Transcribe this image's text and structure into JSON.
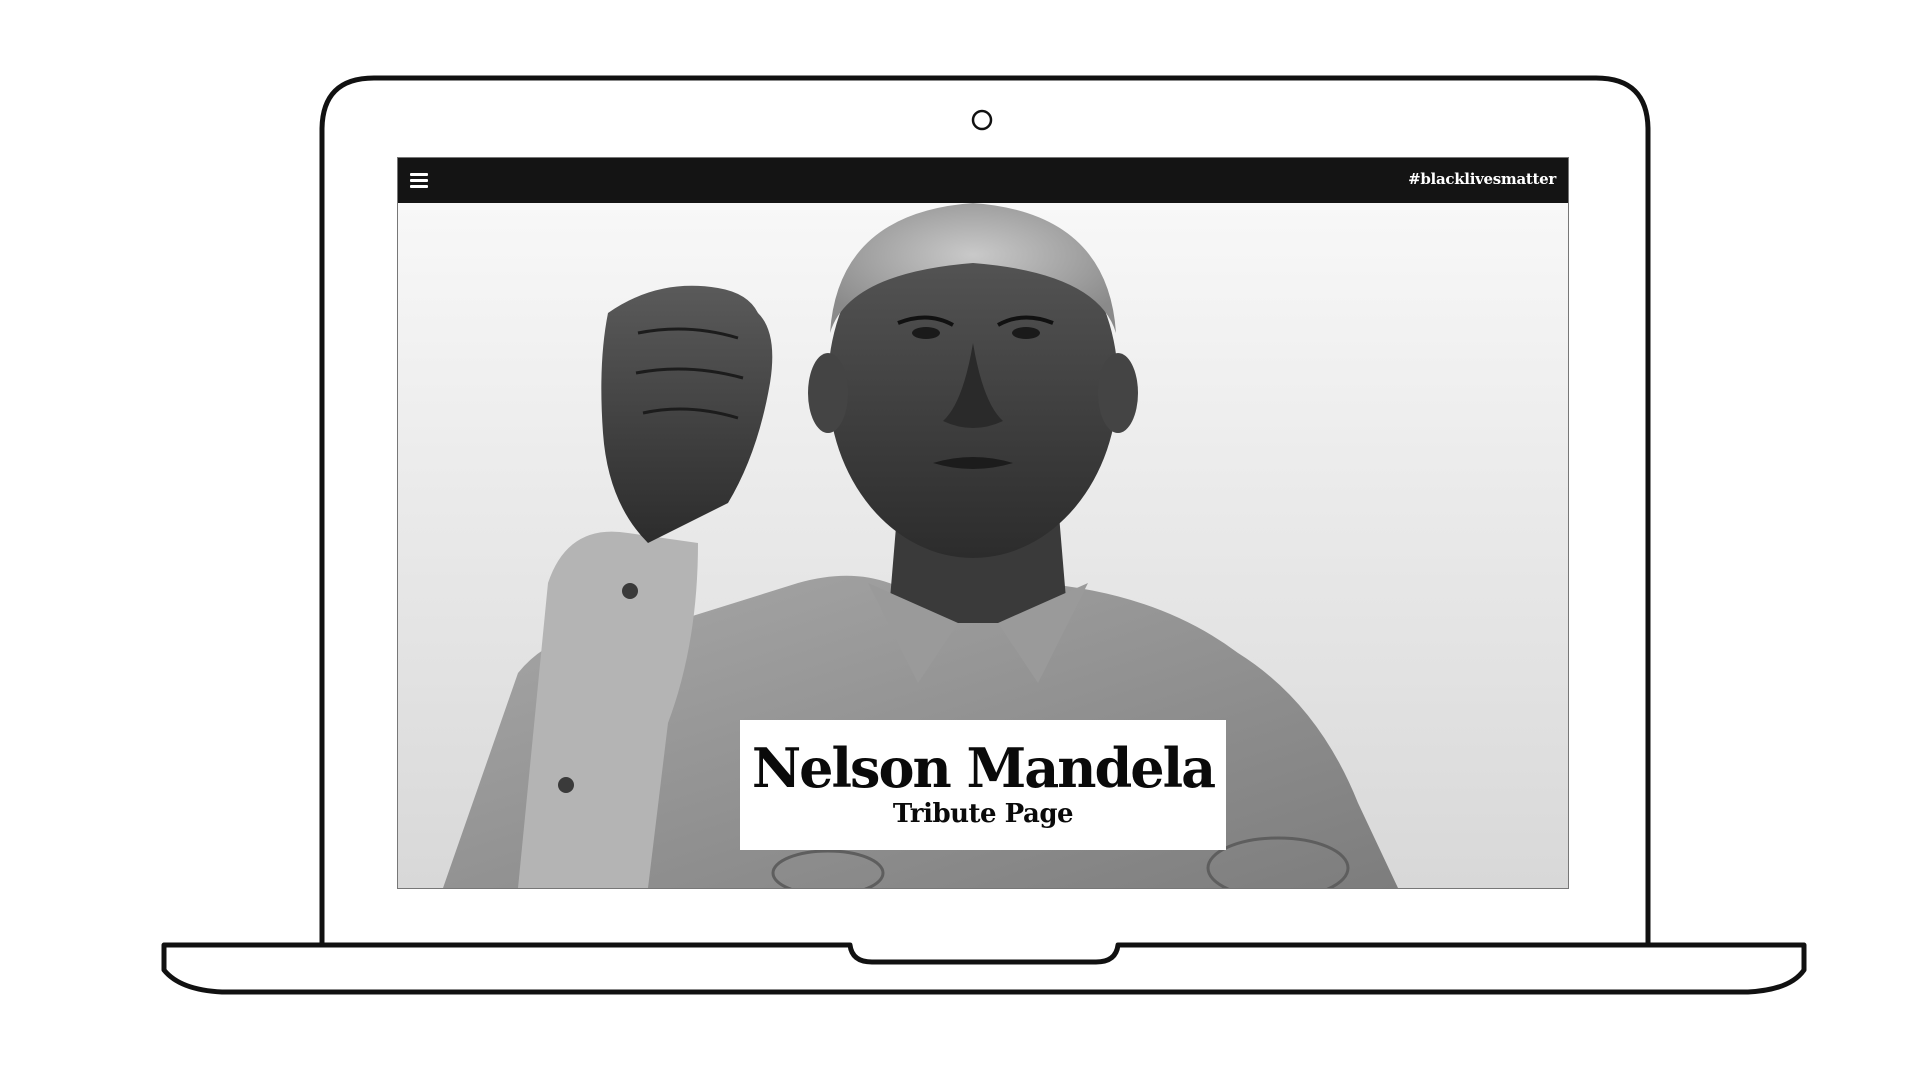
{
  "navbar": {
    "menu_icon": "hamburger-menu-icon",
    "hashtag": "#blacklivesmatter"
  },
  "hero": {
    "photo_icon": "portrait-photo",
    "title": "Nelson Mandela",
    "subtitle": "Tribute Page"
  },
  "device": {
    "camera_icon": "webcam-icon"
  },
  "colors": {
    "navbar_bg": "#141414",
    "navbar_text": "#ffffff",
    "title_card_bg": "#ffffff",
    "title_text": "#0a0a0a",
    "hero_bg_top": "#fafafa",
    "hero_bg_bottom": "#d8d8d8"
  }
}
